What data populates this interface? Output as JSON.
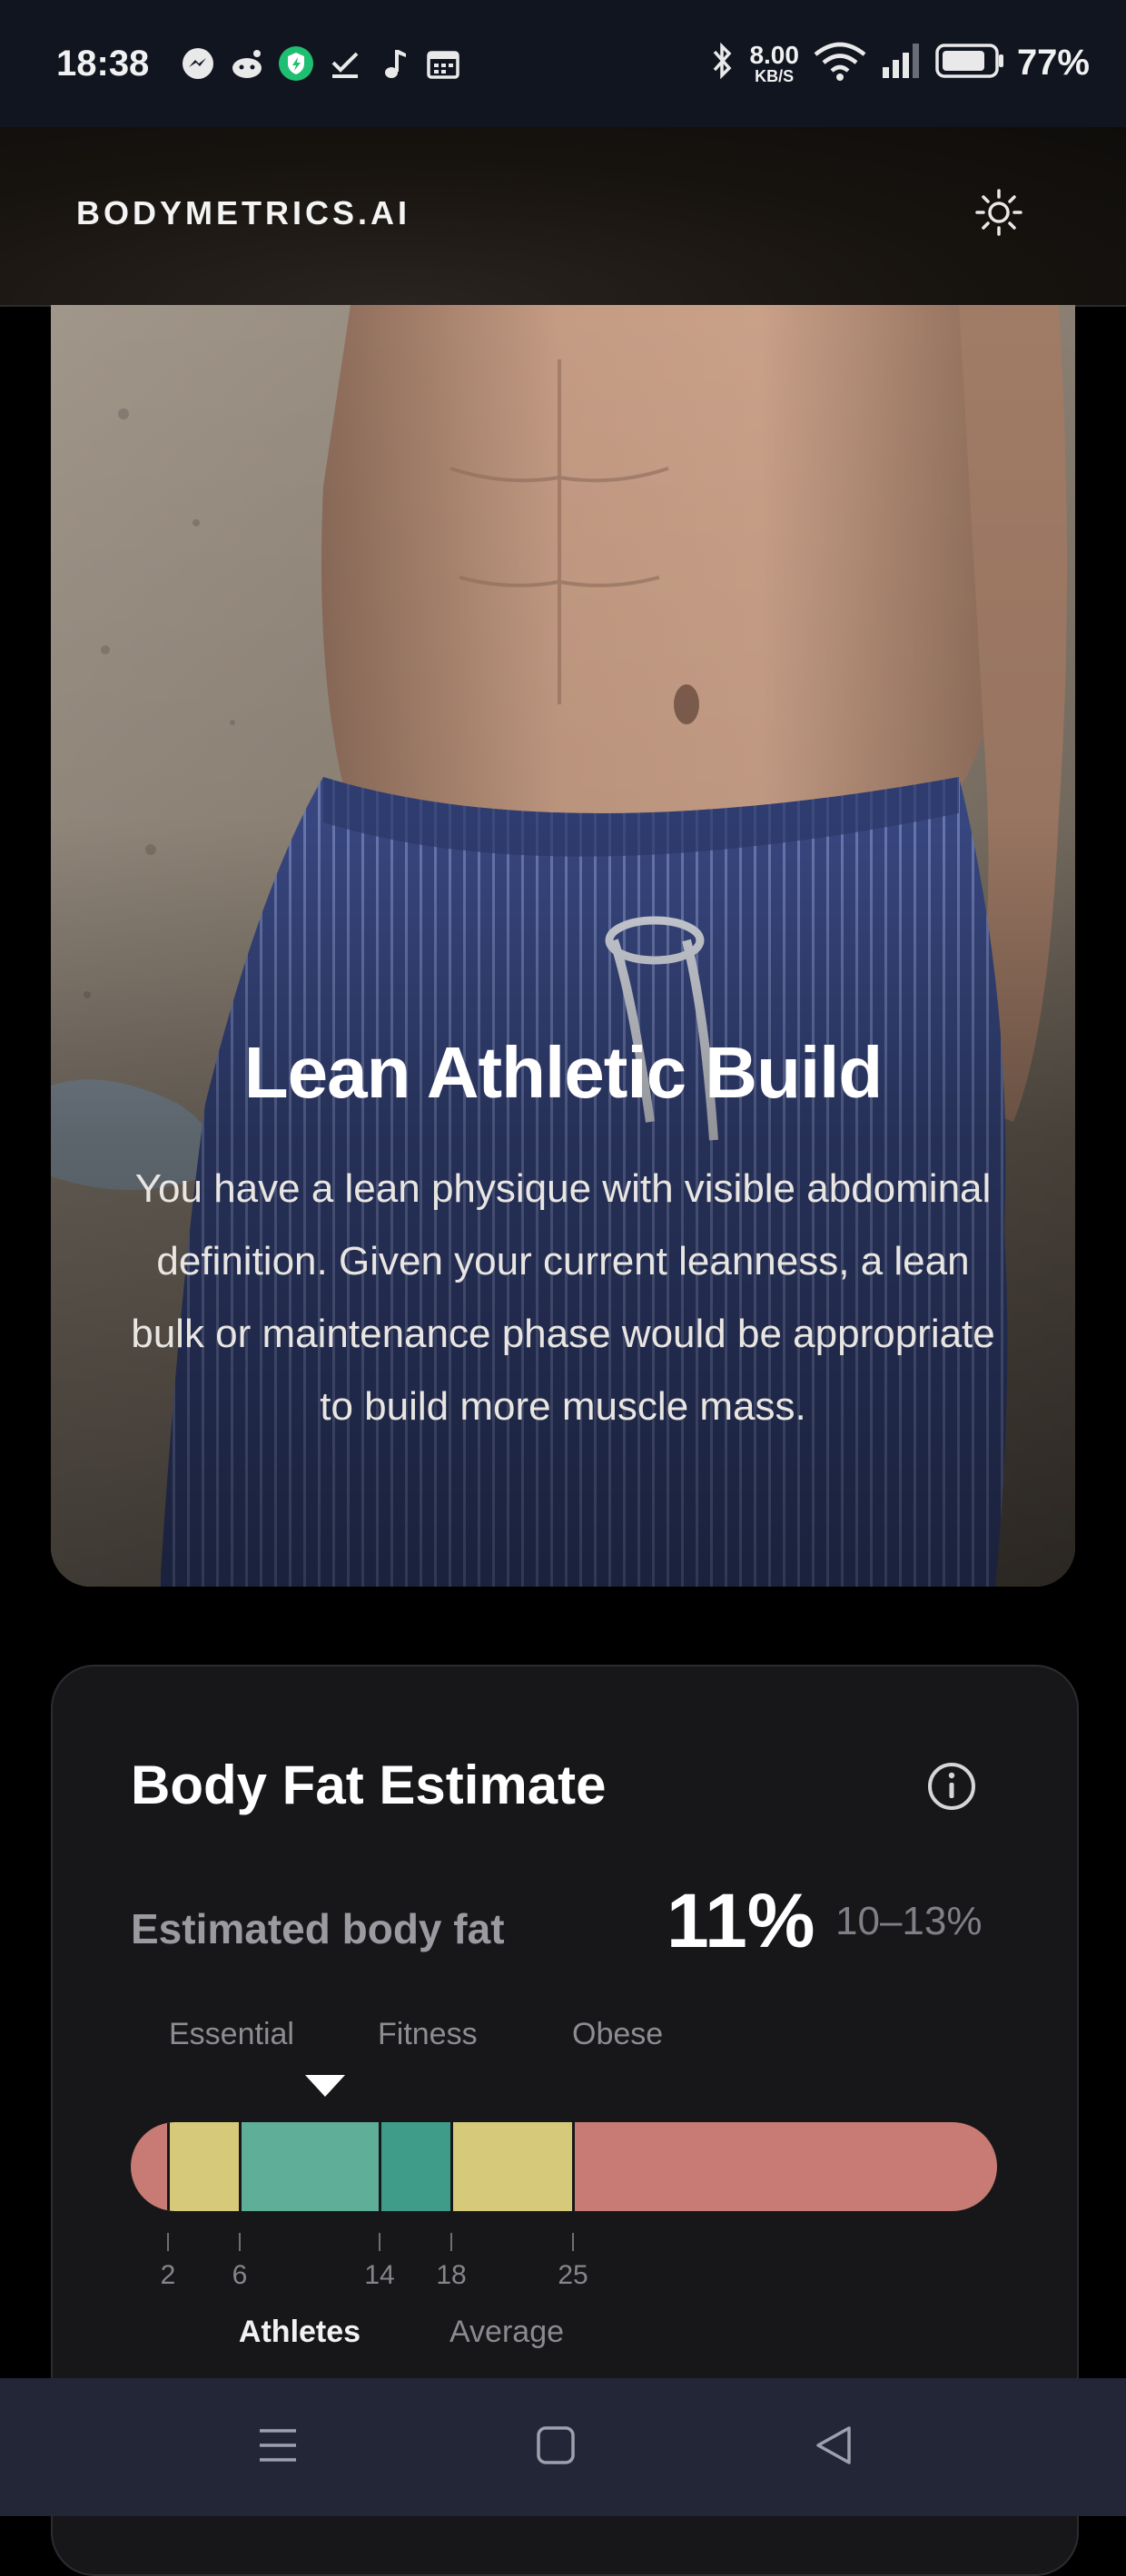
{
  "status_bar": {
    "time": "18:38",
    "net_speed_value": "8.00",
    "net_speed_unit": "KB/S",
    "battery_percent": "77%",
    "icons_left": [
      "messenger-icon",
      "reddit-icon",
      "vpn-shield-icon",
      "download-done-icon",
      "music-note-icon",
      "calendar-icon"
    ],
    "icons_right": [
      "bluetooth-icon",
      "wifi-icon",
      "signal-icon",
      "battery-icon"
    ]
  },
  "header": {
    "brand": "BODYMETRICS.AI",
    "theme_icon": "sun-icon"
  },
  "hero": {
    "title": "Lean Athletic Build",
    "description": "You have a lean physique with visible abdominal definition. Given your current leanness, a lean bulk or maintenance phase would be appropriate to build more muscle mass."
  },
  "body_fat": {
    "title": "Body Fat Estimate",
    "info_icon": "info-icon",
    "label": "Estimated body fat",
    "value": "11%",
    "range": "10–13%",
    "value_number": 11,
    "zones": [
      "Essential",
      "Fitness",
      "Obese"
    ],
    "ticks": [
      "2",
      "6",
      "14",
      "18",
      "25"
    ],
    "categories": [
      "Athletes",
      "Average"
    ],
    "active_category": "Athletes",
    "scale_colors": {
      "essential": "#c87a74",
      "low": "#d6c97a",
      "athletes": "#5fae98",
      "fitness": "#3f9c88",
      "average": "#d6c97a",
      "obese": "#c87a74"
    }
  },
  "nav_bar": {
    "icons": [
      "menu-icon",
      "home-square-icon",
      "back-triangle-icon"
    ]
  }
}
